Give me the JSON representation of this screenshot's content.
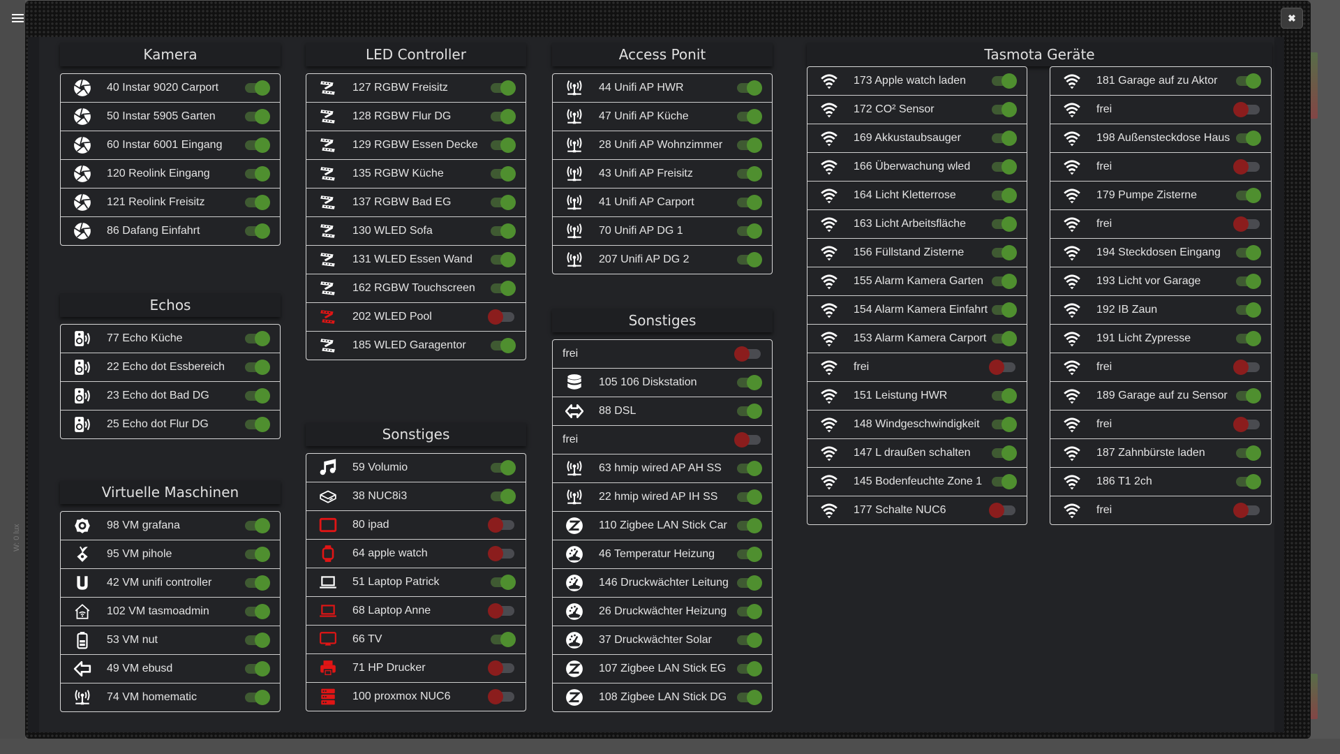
{
  "background": {
    "lux_label": "W: 0 lux"
  },
  "dialog": {
    "close_label": "✖"
  },
  "colors": {
    "on_knob": "#4f8f2f",
    "on_track": "#3f5a32",
    "off_knob": "#8b1d1d",
    "off_track": "#4a4b50",
    "icon_off": "#e01515",
    "icon_on": "#ffffff"
  },
  "groups": [
    {
      "id": "kamera",
      "title": "Kamera",
      "items": [
        {
          "label": "40 Instar 9020 Carport",
          "icon": "camera-aperture",
          "on": true,
          "icon_red": false
        },
        {
          "label": "50 Instar 5905 Garten",
          "icon": "camera-aperture",
          "on": true,
          "icon_red": false
        },
        {
          "label": "60 Instar 6001 Eingang",
          "icon": "camera-aperture",
          "on": true,
          "icon_red": false
        },
        {
          "label": "120 Reolink Eingang",
          "icon": "camera-aperture",
          "on": true,
          "icon_red": false
        },
        {
          "label": "121 Reolink Freisitz",
          "icon": "camera-aperture",
          "on": true,
          "icon_red": false
        },
        {
          "label": "86 Dafang Einfahrt",
          "icon": "camera-aperture",
          "on": true,
          "icon_red": false
        }
      ]
    },
    {
      "id": "echos",
      "title": "Echos",
      "items": [
        {
          "label": "77 Echo Küche",
          "icon": "speaker",
          "on": true,
          "icon_red": false
        },
        {
          "label": "22 Echo dot Essbereich",
          "icon": "speaker",
          "on": true,
          "icon_red": false
        },
        {
          "label": "23 Echo dot Bad DG",
          "icon": "speaker",
          "on": true,
          "icon_red": false
        },
        {
          "label": "25 Echo dot Flur DG",
          "icon": "speaker",
          "on": true,
          "icon_red": false
        }
      ]
    },
    {
      "id": "vms",
      "title": "Virtuelle Maschinen",
      "items": [
        {
          "label": "98 VM grafana",
          "icon": "grafana",
          "on": true,
          "icon_red": false
        },
        {
          "label": "95 VM pihole",
          "icon": "pihole",
          "on": true,
          "icon_red": false
        },
        {
          "label": "42 VM unifi controller",
          "icon": "unifi",
          "on": true,
          "icon_red": false
        },
        {
          "label": "102 VM tasmoadmin",
          "icon": "home-wifi",
          "on": true,
          "icon_red": false
        },
        {
          "label": "53 VM nut",
          "icon": "battery",
          "on": true,
          "icon_red": false
        },
        {
          "label": "49 VM ebusd",
          "icon": "arrow-left",
          "on": true,
          "icon_red": false
        },
        {
          "label": "74 VM homematic",
          "icon": "access-point",
          "on": true,
          "icon_red": false
        }
      ]
    },
    {
      "id": "led",
      "title": "LED Controller",
      "items": [
        {
          "label": "127 RGBW Freisitz",
          "icon": "led-strip",
          "on": true,
          "icon_red": false
        },
        {
          "label": "128 RGBW Flur DG",
          "icon": "led-strip",
          "on": true,
          "icon_red": false
        },
        {
          "label": "129 RGBW Essen Decke",
          "icon": "led-strip",
          "on": true,
          "icon_red": false
        },
        {
          "label": "135 RGBW Küche",
          "icon": "led-strip",
          "on": true,
          "icon_red": false
        },
        {
          "label": "137 RGBW Bad EG",
          "icon": "led-strip",
          "on": true,
          "icon_red": false
        },
        {
          "label": "130 WLED Sofa",
          "icon": "led-strip",
          "on": true,
          "icon_red": false
        },
        {
          "label": "131 WLED Essen Wand",
          "icon": "led-strip",
          "on": true,
          "icon_red": false
        },
        {
          "label": "162 RGBW Touchscreen",
          "icon": "led-strip",
          "on": true,
          "icon_red": false
        },
        {
          "label": "202 WLED Pool",
          "icon": "led-strip",
          "on": false,
          "icon_red": true
        },
        {
          "label": "185 WLED Garagentor",
          "icon": "led-strip",
          "on": true,
          "icon_red": false
        }
      ]
    },
    {
      "id": "sonstiges1",
      "title": "Sonstiges",
      "items": [
        {
          "label": "59 Volumio",
          "icon": "music",
          "on": true,
          "icon_red": false
        },
        {
          "label": "38 NUC8i3",
          "icon": "mini-pc",
          "on": true,
          "icon_red": false
        },
        {
          "label": "80 ipad",
          "icon": "tablet",
          "on": false,
          "icon_red": true
        },
        {
          "label": "64 apple watch",
          "icon": "watch",
          "on": false,
          "icon_red": true
        },
        {
          "label": "51 Laptop Patrick",
          "icon": "laptop",
          "on": true,
          "icon_red": false
        },
        {
          "label": "68 Laptop Anne",
          "icon": "laptop",
          "on": false,
          "icon_red": true
        },
        {
          "label": "66 TV",
          "icon": "tv",
          "on": true,
          "icon_red": true
        },
        {
          "label": "71 HP Drucker",
          "icon": "printer",
          "on": false,
          "icon_red": true
        },
        {
          "label": "100 proxmox NUC6",
          "icon": "server",
          "on": false,
          "icon_red": true
        }
      ]
    },
    {
      "id": "accesspoint",
      "title": "Access Ponit",
      "items": [
        {
          "label": "44 Unifi AP HWR",
          "icon": "access-point",
          "on": true,
          "icon_red": false
        },
        {
          "label": "47 Unifi AP Küche",
          "icon": "access-point",
          "on": true,
          "icon_red": false
        },
        {
          "label": "28 Unifi AP Wohnzimmer",
          "icon": "access-point",
          "on": true,
          "icon_red": false
        },
        {
          "label": "43 Unifi AP Freisitz",
          "icon": "access-point",
          "on": true,
          "icon_red": false
        },
        {
          "label": "41 Unifi AP Carport",
          "icon": "access-point",
          "on": true,
          "icon_red": false
        },
        {
          "label": "70 Unifi AP DG 1",
          "icon": "access-point",
          "on": true,
          "icon_red": false
        },
        {
          "label": "207 Unifi AP DG 2",
          "icon": "access-point",
          "on": true,
          "icon_red": false
        }
      ]
    },
    {
      "id": "sonstiges2",
      "title": "Sonstiges",
      "items": [
        {
          "label": "frei",
          "icon": "",
          "on": false,
          "icon_red": false
        },
        {
          "label": "105 106 Diskstation",
          "icon": "database",
          "on": true,
          "icon_red": false
        },
        {
          "label": "88 DSL",
          "icon": "arrows-horizontal",
          "on": true,
          "icon_red": false
        },
        {
          "label": "frei",
          "icon": "",
          "on": false,
          "icon_red": false
        },
        {
          "label": "63 hmip wired AP AH SS",
          "icon": "access-point",
          "on": true,
          "icon_red": false
        },
        {
          "label": "22 hmip wired AP IH SS",
          "icon": "access-point",
          "on": true,
          "icon_red": false
        },
        {
          "label": "110 Zigbee LAN Stick Car",
          "icon": "zigbee",
          "on": true,
          "icon_red": false
        },
        {
          "label": "46 Temperatur Heizung",
          "icon": "gauge",
          "on": true,
          "icon_red": false
        },
        {
          "label": "146 Druckwächter Leitung",
          "icon": "gauge",
          "on": true,
          "icon_red": false
        },
        {
          "label": "26 Druckwächter Heizung",
          "icon": "gauge",
          "on": true,
          "icon_red": false
        },
        {
          "label": "37 Druckwächter Solar",
          "icon": "gauge",
          "on": true,
          "icon_red": false
        },
        {
          "label": "107 Zigbee LAN Stick EG",
          "icon": "zigbee",
          "on": true,
          "icon_red": false
        },
        {
          "label": "108 Zigbee LAN Stick DG",
          "icon": "zigbee",
          "on": true,
          "icon_red": false
        }
      ]
    },
    {
      "id": "tasmota",
      "title": "Tasmota Geräte",
      "items": []
    },
    {
      "id": "tasmota_a",
      "title": "",
      "items": [
        {
          "label": "173 Apple watch laden",
          "icon": "wifi",
          "on": true,
          "icon_red": false
        },
        {
          "label": "172 CO² Sensor",
          "icon": "wifi",
          "on": true,
          "icon_red": false
        },
        {
          "label": "169 Akkustaubsauger",
          "icon": "wifi",
          "on": true,
          "icon_red": false
        },
        {
          "label": "166 Überwachung wled",
          "icon": "wifi",
          "on": true,
          "icon_red": false
        },
        {
          "label": "164 Licht Kletterrose",
          "icon": "wifi",
          "on": true,
          "icon_red": false
        },
        {
          "label": "163 Licht Arbeitsfläche",
          "icon": "wifi",
          "on": true,
          "icon_red": false
        },
        {
          "label": "156 Füllstand Zisterne",
          "icon": "wifi",
          "on": true,
          "icon_red": false
        },
        {
          "label": "155 Alarm Kamera Garten",
          "icon": "wifi",
          "on": true,
          "icon_red": false
        },
        {
          "label": "154 Alarm Kamera Einfahrt",
          "icon": "wifi",
          "on": true,
          "icon_red": false
        },
        {
          "label": "153 Alarm Kamera Carport",
          "icon": "wifi",
          "on": true,
          "icon_red": false
        },
        {
          "label": "frei",
          "icon": "wifi",
          "on": false,
          "icon_red": false
        },
        {
          "label": "151 Leistung HWR",
          "icon": "wifi",
          "on": true,
          "icon_red": false
        },
        {
          "label": "148 Windgeschwindigkeit",
          "icon": "wifi",
          "on": true,
          "icon_red": false
        },
        {
          "label": "147 L draußen schalten",
          "icon": "wifi",
          "on": true,
          "icon_red": false
        },
        {
          "label": "145 Bodenfeuchte Zone 1",
          "icon": "wifi",
          "on": true,
          "icon_red": false
        },
        {
          "label": "177 Schalte NUC6",
          "icon": "wifi",
          "on": false,
          "icon_red": false
        }
      ]
    },
    {
      "id": "tasmota_b",
      "title": "",
      "items": [
        {
          "label": "181 Garage auf zu Aktor",
          "icon": "wifi",
          "on": true,
          "icon_red": false
        },
        {
          "label": "frei",
          "icon": "wifi",
          "on": false,
          "icon_red": false
        },
        {
          "label": "198 Außensteckdose Haus",
          "icon": "wifi",
          "on": true,
          "icon_red": false
        },
        {
          "label": "frei",
          "icon": "wifi",
          "on": false,
          "icon_red": false
        },
        {
          "label": "179 Pumpe Zisterne",
          "icon": "wifi",
          "on": true,
          "icon_red": false
        },
        {
          "label": "frei",
          "icon": "wifi",
          "on": false,
          "icon_red": false
        },
        {
          "label": "194 Steckdosen Eingang",
          "icon": "wifi",
          "on": true,
          "icon_red": false
        },
        {
          "label": "193 Licht vor Garage",
          "icon": "wifi",
          "on": true,
          "icon_red": false
        },
        {
          "label": "192 IB Zaun",
          "icon": "wifi",
          "on": true,
          "icon_red": false
        },
        {
          "label": "191 Licht Zypresse",
          "icon": "wifi",
          "on": true,
          "icon_red": false
        },
        {
          "label": "frei",
          "icon": "wifi",
          "on": false,
          "icon_red": false
        },
        {
          "label": "189 Garage auf zu Sensor",
          "icon": "wifi",
          "on": true,
          "icon_red": false
        },
        {
          "label": "frei",
          "icon": "wifi",
          "on": false,
          "icon_red": false
        },
        {
          "label": "187 Zahnbürste laden",
          "icon": "wifi",
          "on": true,
          "icon_red": false
        },
        {
          "label": "186 T1 2ch",
          "icon": "wifi",
          "on": true,
          "icon_red": false
        },
        {
          "label": "frei",
          "icon": "wifi",
          "on": false,
          "icon_red": false
        }
      ]
    }
  ]
}
